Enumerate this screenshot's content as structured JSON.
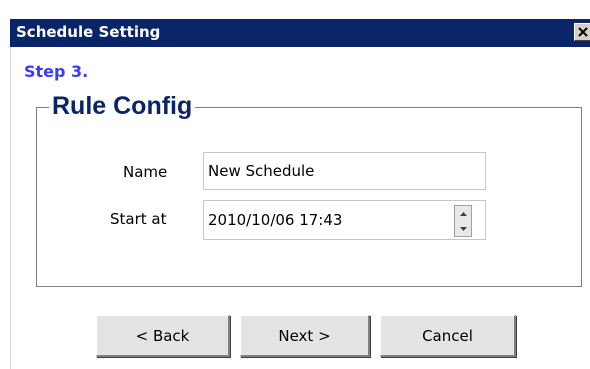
{
  "window": {
    "title": "Schedule Setting",
    "close_label": "Close"
  },
  "wizard": {
    "step": "Step 3.",
    "section_title": "Rule Config"
  },
  "form": {
    "name_label": "Name",
    "name_value": "New Schedule",
    "start_label": "Start at",
    "start_value": "2010/10/06 17:43"
  },
  "buttons": {
    "back": "< Back",
    "next": "Next >",
    "cancel": "Cancel"
  },
  "colors": {
    "titlebar": "#0a246a",
    "step_text": "#3a3aff",
    "section_title": "#0a246a"
  }
}
